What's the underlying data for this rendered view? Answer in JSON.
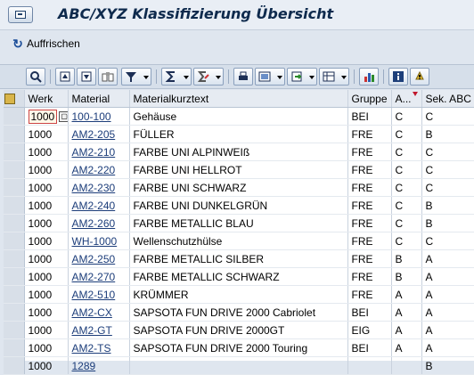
{
  "window": {
    "title": "ABC/XYZ Klassifizierung Übersicht",
    "menu_icon": "menu-screen-icon"
  },
  "appbar": {
    "refresh_label": "Auffrischen",
    "refresh_icon": "refresh-icon"
  },
  "toolbar": {
    "buttons": [
      {
        "name": "details-icon"
      },
      {
        "name": "sort-ascending-icon"
      },
      {
        "name": "sort-descending-icon"
      },
      {
        "name": "find-icon"
      },
      {
        "name": "filter-icon"
      },
      {
        "name": "sum-icon"
      },
      {
        "name": "subtotal-icon"
      },
      {
        "name": "print-icon"
      },
      {
        "name": "views-icon"
      },
      {
        "name": "export-icon"
      },
      {
        "name": "layout-icon"
      },
      {
        "name": "graphic-icon"
      },
      {
        "name": "info-icon"
      },
      {
        "name": "more-icon"
      }
    ]
  },
  "grid": {
    "columns": [
      "Werk",
      "Material",
      "Materialkurztext",
      "Gruppe",
      "A...",
      "Sek. ABC"
    ],
    "rows": [
      {
        "werk": "1000",
        "material": "100-100",
        "text": "Gehäuse",
        "gruppe": "BEI",
        "a": "C",
        "sek": "C"
      },
      {
        "werk": "1000",
        "material": "AM2-205",
        "text": "FÜLLER",
        "gruppe": "FRE",
        "a": "C",
        "sek": "B"
      },
      {
        "werk": "1000",
        "material": "AM2-210",
        "text": "FARBE UNI ALPINWEIß",
        "gruppe": "FRE",
        "a": "C",
        "sek": "C"
      },
      {
        "werk": "1000",
        "material": "AM2-220",
        "text": "FARBE UNI HELLROT",
        "gruppe": "FRE",
        "a": "C",
        "sek": "C"
      },
      {
        "werk": "1000",
        "material": "AM2-230",
        "text": "FARBE UNI SCHWARZ",
        "gruppe": "FRE",
        "a": "C",
        "sek": "C"
      },
      {
        "werk": "1000",
        "material": "AM2-240",
        "text": "FARBE UNI DUNKELGRÜN",
        "gruppe": "FRE",
        "a": "C",
        "sek": "B"
      },
      {
        "werk": "1000",
        "material": "AM2-260",
        "text": "FARBE METALLIC BLAU",
        "gruppe": "FRE",
        "a": "C",
        "sek": "B"
      },
      {
        "werk": "1000",
        "material": "WH-1000",
        "text": "Wellenschutzhülse",
        "gruppe": "FRE",
        "a": "C",
        "sek": "C"
      },
      {
        "werk": "1000",
        "material": "AM2-250",
        "text": "FARBE METALLIC SILBER",
        "gruppe": "FRE",
        "a": "B",
        "sek": "A"
      },
      {
        "werk": "1000",
        "material": "AM2-270",
        "text": "FARBE METALLIC SCHWARZ",
        "gruppe": "FRE",
        "a": "B",
        "sek": "A"
      },
      {
        "werk": "1000",
        "material": "AM2-510",
        "text": "KRÜMMER",
        "gruppe": "FRE",
        "a": "A",
        "sek": "A"
      },
      {
        "werk": "1000",
        "material": "AM2-CX",
        "text": "SAPSOTA FUN DRIVE 2000 Cabriolet",
        "gruppe": "BEI",
        "a": "A",
        "sek": "A"
      },
      {
        "werk": "1000",
        "material": "AM2-GT",
        "text": "SAPSOTA FUN DRIVE 2000GT",
        "gruppe": "EIG",
        "a": "A",
        "sek": "A"
      },
      {
        "werk": "1000",
        "material": "AM2-TS",
        "text": "SAPSOTA FUN DRIVE 2000 Touring",
        "gruppe": "BEI",
        "a": "A",
        "sek": "A"
      },
      {
        "werk": "1000",
        "material": "1289",
        "text": "",
        "gruppe": "",
        "a": "",
        "sek": "B"
      }
    ]
  }
}
